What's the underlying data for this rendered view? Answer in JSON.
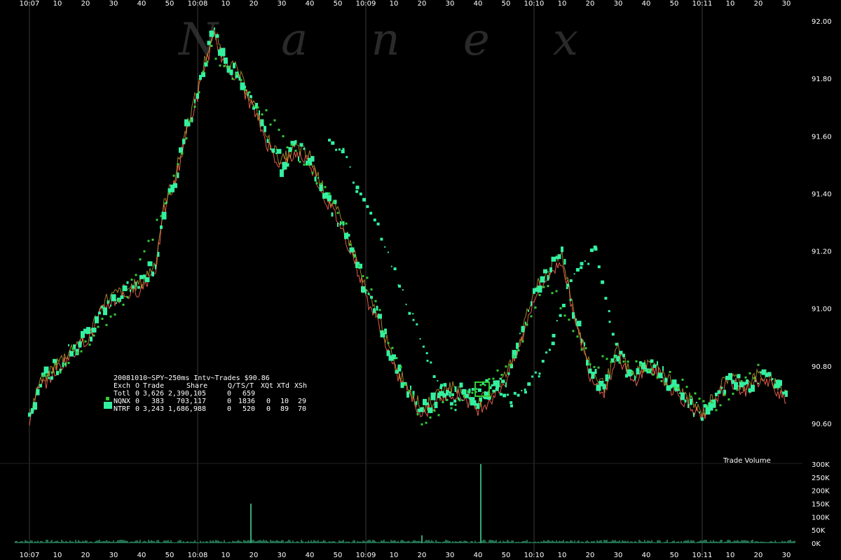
{
  "colors": {
    "background": "#000000",
    "grid": "#3a3a3a",
    "nqnx": "#33cc33",
    "ntrf": "#33f0a0",
    "nbbo_bid": "#e05a4a",
    "nbbo_ask": "#c8a030",
    "volume": "#44e0a0",
    "text": "#ffffff"
  },
  "watermark": "N a n e x",
  "info": {
    "title": "20081010~SPY~250ms Intv~Trades $90.86",
    "header": [
      "Exch",
      "O",
      "Trade",
      "Share",
      "Q/T",
      "S/T",
      "XQt",
      "XTd",
      "XSh"
    ],
    "rows": [
      {
        "name": "Totl",
        "o": "0",
        "trade": "3,626",
        "share": "2,390,105",
        "qt": "0",
        "st": "659",
        "xqt": "",
        "xtd": "",
        "xsh": ""
      },
      {
        "name": "NQNX",
        "o": "0",
        "trade": "383",
        "share": "703,117",
        "qt": "0",
        "st": "1836",
        "xqt": "0",
        "xtd": "10",
        "xsh": "29"
      },
      {
        "name": "NTRF",
        "o": "0",
        "trade": "3,243",
        "share": "1,686,988",
        "qt": "0",
        "st": "520",
        "xqt": "0",
        "xtd": "89",
        "xsh": "70"
      }
    ]
  },
  "chart_data": {
    "type": "scatter",
    "title": "20081010~SPY~250ms Intv~Trades $90.86",
    "time_axis": {
      "range_seconds": [
        "10:07:00",
        "10:11:35"
      ],
      "major_labels": [
        "10:07",
        "10:08",
        "10:09",
        "10:10",
        "10:11"
      ],
      "minor_labels": [
        "10",
        "20",
        "30",
        "40",
        "50"
      ]
    },
    "price_axis": {
      "ylim": [
        90.5,
        92.0
      ],
      "ticks": [
        "92.00",
        "91.80",
        "91.60",
        "91.40",
        "91.20",
        "91.00",
        "90.80",
        "90.60"
      ]
    },
    "volume_axis": {
      "label": "Trade Volume",
      "ylim": [
        0,
        300000
      ],
      "ticks": [
        "300K",
        "250K",
        "200K",
        "150K",
        "100K",
        "50K",
        "0K"
      ]
    },
    "series": [
      {
        "name": "NTRF",
        "price_path": [
          [
            "10:07:00",
            90.62
          ],
          [
            "10:07:03",
            90.72
          ],
          [
            "10:07:08",
            90.78
          ],
          [
            "10:07:15",
            90.85
          ],
          [
            "10:07:22",
            90.92
          ],
          [
            "10:07:27",
            91.02
          ],
          [
            "10:07:33",
            91.05
          ],
          [
            "10:07:40",
            91.08
          ],
          [
            "10:07:45",
            91.15
          ],
          [
            "10:07:48",
            91.35
          ],
          [
            "10:07:52",
            91.45
          ],
          [
            "10:07:56",
            91.62
          ],
          [
            "10:08:00",
            91.75
          ],
          [
            "10:08:03",
            91.87
          ],
          [
            "10:08:06",
            91.95
          ],
          [
            "10:08:10",
            91.85
          ],
          [
            "10:08:14",
            91.82
          ],
          [
            "10:08:20",
            91.7
          ],
          [
            "10:08:25",
            91.58
          ],
          [
            "10:08:30",
            91.5
          ],
          [
            "10:08:35",
            91.55
          ],
          [
            "10:08:40",
            91.52
          ],
          [
            "10:08:45",
            91.4
          ],
          [
            "10:08:50",
            91.32
          ],
          [
            "10:08:56",
            91.18
          ],
          [
            "10:09:00",
            91.05
          ],
          [
            "10:09:05",
            90.95
          ],
          [
            "10:09:10",
            90.8
          ],
          [
            "10:09:15",
            90.72
          ],
          [
            "10:09:20",
            90.64
          ],
          [
            "10:09:25",
            90.68
          ],
          [
            "10:09:30",
            90.72
          ],
          [
            "10:09:35",
            90.7
          ],
          [
            "10:09:40",
            90.66
          ],
          [
            "10:09:45",
            90.7
          ],
          [
            "10:09:50",
            90.76
          ],
          [
            "10:09:55",
            90.88
          ],
          [
            "10:10:00",
            91.05
          ],
          [
            "10:10:05",
            91.12
          ],
          [
            "10:10:10",
            91.18
          ],
          [
            "10:10:15",
            90.95
          ],
          [
            "10:10:20",
            90.78
          ],
          [
            "10:10:25",
            90.72
          ],
          [
            "10:10:30",
            90.85
          ],
          [
            "10:10:35",
            90.75
          ],
          [
            "10:10:40",
            90.8
          ],
          [
            "10:10:45",
            90.78
          ],
          [
            "10:10:50",
            90.72
          ],
          [
            "10:10:55",
            90.68
          ],
          [
            "10:11:00",
            90.62
          ],
          [
            "10:11:05",
            90.7
          ],
          [
            "10:11:10",
            90.76
          ],
          [
            "10:11:15",
            90.72
          ],
          [
            "10:11:20",
            90.76
          ],
          [
            "10:11:25",
            90.74
          ],
          [
            "10:11:30",
            90.7
          ]
        ]
      },
      {
        "name": "NQNX",
        "price_path": [
          [
            "10:07:05",
            90.75
          ],
          [
            "10:07:20",
            90.88
          ],
          [
            "10:07:35",
            91.05
          ],
          [
            "10:07:50",
            91.4
          ],
          [
            "10:08:05",
            91.9
          ],
          [
            "10:08:20",
            91.72
          ],
          [
            "10:08:35",
            91.55
          ],
          [
            "10:08:50",
            91.35
          ],
          [
            "10:09:05",
            90.98
          ],
          [
            "10:09:20",
            90.6
          ],
          [
            "10:09:35",
            90.7
          ],
          [
            "10:09:50",
            90.78
          ],
          [
            "10:10:05",
            91.1
          ],
          [
            "10:10:20",
            90.82
          ],
          [
            "10:10:35",
            90.8
          ],
          [
            "10:10:50",
            90.75
          ],
          [
            "10:11:05",
            90.66
          ],
          [
            "10:11:20",
            90.78
          ]
        ]
      }
    ],
    "volume_spikes": [
      {
        "time": "10:08:19",
        "volume": 150000
      },
      {
        "time": "10:09:41",
        "volume": 300000
      },
      {
        "time": "10:09:20",
        "volume": 30000
      }
    ]
  }
}
